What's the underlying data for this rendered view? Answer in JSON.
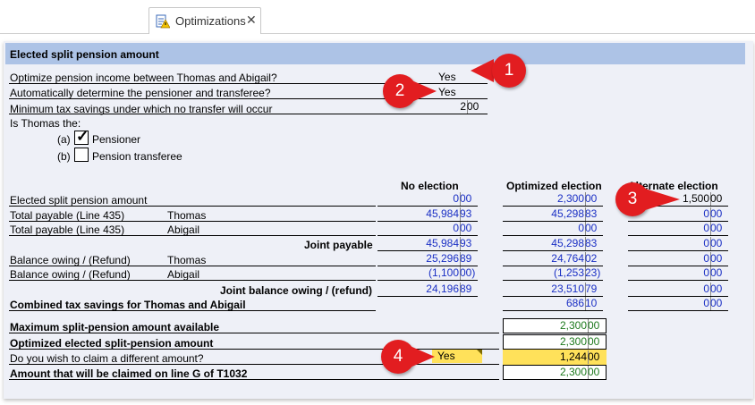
{
  "tab": {
    "label": "Optimizations",
    "close": "✕"
  },
  "section": {
    "title": "Elected split pension amount"
  },
  "questions": {
    "q1_label": "Optimize pension income between Thomas and Abigail?",
    "q1_value": "Yes",
    "q2_label": "Automatically determine the pensioner and transferee?",
    "q2_value": "Yes",
    "q3_label": "Minimum tax savings under which no transfer will occur",
    "q3_whole": "2",
    "q3_cents": "00",
    "q4_label": "Is Thomas the:",
    "opt_a_prefix": "(a)",
    "opt_a_label": "Pensioner",
    "opt_a_check": "✓",
    "opt_b_prefix": "(b)",
    "opt_b_label": "Pension transferee"
  },
  "columns": {
    "no_election": "No election",
    "optimized": "Optimized election",
    "alternate": "Alternate election"
  },
  "rows": {
    "elected": "Elected split pension amount",
    "total_payable": "Total payable (Line 435)",
    "joint_payable": "Joint payable",
    "balance_owing": "Balance owing / (Refund)",
    "joint_balance": "Joint balance owing / (refund)",
    "combined_savings": "Combined tax savings for Thomas and Abigail",
    "thomas": "Thomas",
    "abigail": "Abigail"
  },
  "values": {
    "no_election": {
      "elected": [
        "0",
        "00"
      ],
      "tp_thomas": [
        "45,984",
        "93"
      ],
      "tp_abigail": [
        "0",
        "00"
      ],
      "joint_payable": [
        "45,984",
        "93"
      ],
      "bo_thomas": [
        "25,296",
        "89"
      ],
      "bo_abigail": [
        "(1,100",
        "00)"
      ],
      "joint_balance": [
        "24,196",
        "89"
      ]
    },
    "optimized": {
      "elected": [
        "2,300",
        "00"
      ],
      "tp_thomas": [
        "45,298",
        "83"
      ],
      "tp_abigail": [
        "0",
        "00"
      ],
      "joint_payable": [
        "45,298",
        "83"
      ],
      "bo_thomas": [
        "24,764",
        "02"
      ],
      "bo_abigail": [
        "(1,253",
        "23)"
      ],
      "joint_balance": [
        "23,510",
        "79"
      ],
      "combined": [
        "686",
        "10"
      ]
    },
    "alternate": {
      "elected": [
        "1,500",
        "00"
      ],
      "tp_thomas": [
        "0",
        "00"
      ],
      "tp_abigail": [
        "0",
        "00"
      ],
      "joint_payable": [
        "0",
        "00"
      ],
      "bo_thomas": [
        "0",
        "00"
      ],
      "bo_abigail": [
        "0",
        "00"
      ],
      "joint_balance": [
        "0",
        "00"
      ],
      "combined": [
        "0",
        "00"
      ]
    }
  },
  "bottom": {
    "max_label": "Maximum split-pension amount available",
    "max_value": [
      "2,300",
      "00"
    ],
    "opt_label": "Optimized elected split-pension amount",
    "opt_value": [
      "2,300",
      "00"
    ],
    "diff_label": "Do you wish to claim a different amount?",
    "diff_answer": "Yes",
    "diff_value": [
      "1,244",
      "00"
    ],
    "claim_label": "Amount that will be claimed on line G of T1032",
    "claim_value": [
      "2,300",
      "00"
    ]
  },
  "callouts": [
    "1",
    "2",
    "3",
    "4"
  ],
  "colors": {
    "header_band": "#adc3e6",
    "callout": "#e21d20",
    "value_blue": "#1a2fc4",
    "highlight": "#ffe15a",
    "value_green": "#1e7a1e"
  }
}
